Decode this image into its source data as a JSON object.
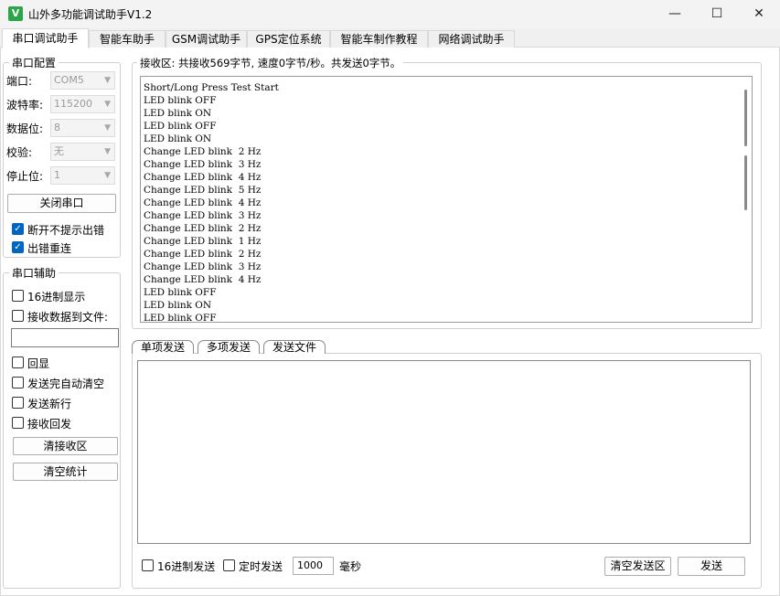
{
  "window": {
    "title": "山外多功能调试助手V1.2",
    "icon_letter": "V",
    "minimize_glyph": "—",
    "maximize_glyph": "☐",
    "close_glyph": "✕"
  },
  "tabs": [
    {
      "label": "串口调试助手",
      "active": true
    },
    {
      "label": "智能车助手"
    },
    {
      "label": "GSM调试助手"
    },
    {
      "label": "GPS定位系统"
    },
    {
      "label": "智能车制作教程"
    },
    {
      "label": "网络调试助手"
    }
  ],
  "serial_config": {
    "title": "串口配置",
    "fields": [
      {
        "label": "端口:",
        "value": "COM5"
      },
      {
        "label": "波特率:",
        "value": "115200"
      },
      {
        "label": "数据位:",
        "value": "8"
      },
      {
        "label": "校验:",
        "value": "无"
      },
      {
        "label": "停止位:",
        "value": "1"
      }
    ],
    "close_button": "关闭串口",
    "checkboxes": [
      {
        "label": "断开不提示出错",
        "checked": true
      },
      {
        "label": "出错重连",
        "checked": true
      }
    ]
  },
  "serial_aux": {
    "title": "串口辅助",
    "hex_display": "16进制显示",
    "save_to_file": "接收数据到文件:",
    "file_path": "",
    "options": [
      "回显",
      "发送完自动清空",
      "发送新行",
      "接收回发"
    ],
    "clear_rx_button": "清接收区",
    "clear_stats_button": "清空统计"
  },
  "receive": {
    "header": "接收区: 共接收569字节, 速度0字节/秒。共发送0字节。",
    "lines": [
      "Short/Long Press Test Start",
      "LED blink OFF",
      "LED blink ON",
      "LED blink OFF",
      "LED blink ON",
      "Change LED blink  2 Hz",
      "Change LED blink  3 Hz",
      "Change LED blink  4 Hz",
      "Change LED blink  5 Hz",
      "Change LED blink  4 Hz",
      "Change LED blink  3 Hz",
      "Change LED blink  2 Hz",
      "Change LED blink  1 Hz",
      "Change LED blink  2 Hz",
      "Change LED blink  3 Hz",
      "Change LED blink  4 Hz",
      "LED blink OFF",
      "LED blink ON",
      "LED blink OFF"
    ]
  },
  "send": {
    "tabs": [
      "单项发送",
      "多项发送",
      "发送文件"
    ],
    "text": "",
    "hex_send": "16进制发送",
    "timed_send": "定时发送",
    "interval": "1000",
    "unit": "毫秒",
    "clear_button": "清空发送区",
    "send_button": "发送"
  }
}
